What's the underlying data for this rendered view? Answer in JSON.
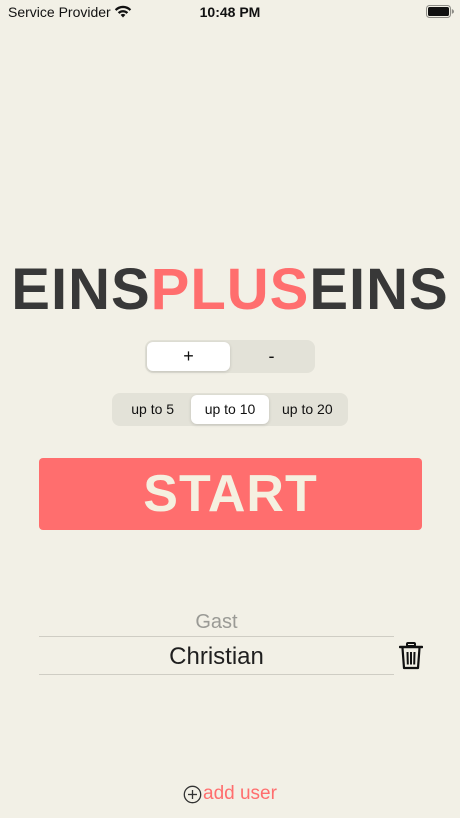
{
  "status_bar": {
    "carrier": "Service Provider",
    "time": "10:48 PM",
    "wifi_icon": "wifi-icon",
    "battery_icon": "battery-icon"
  },
  "title": {
    "part1": "EINS",
    "part2": "PLUS",
    "part3": "EINS"
  },
  "colors": {
    "background": "#f2f0e6",
    "accent": "#ff6e6e",
    "title_dark": "#383838"
  },
  "operator_control": {
    "options": [
      "+",
      "-"
    ],
    "selected": "+"
  },
  "range_control": {
    "options": [
      "up to 5",
      "up to 10",
      "up to 20"
    ],
    "selected": "up to 10"
  },
  "start_button": {
    "label": "START"
  },
  "users": {
    "items": [
      {
        "name": "Gast"
      },
      {
        "name": "Christian"
      }
    ],
    "delete_icon": "trash-icon"
  },
  "add_user": {
    "label": "add user",
    "icon": "plus-circle-icon"
  }
}
